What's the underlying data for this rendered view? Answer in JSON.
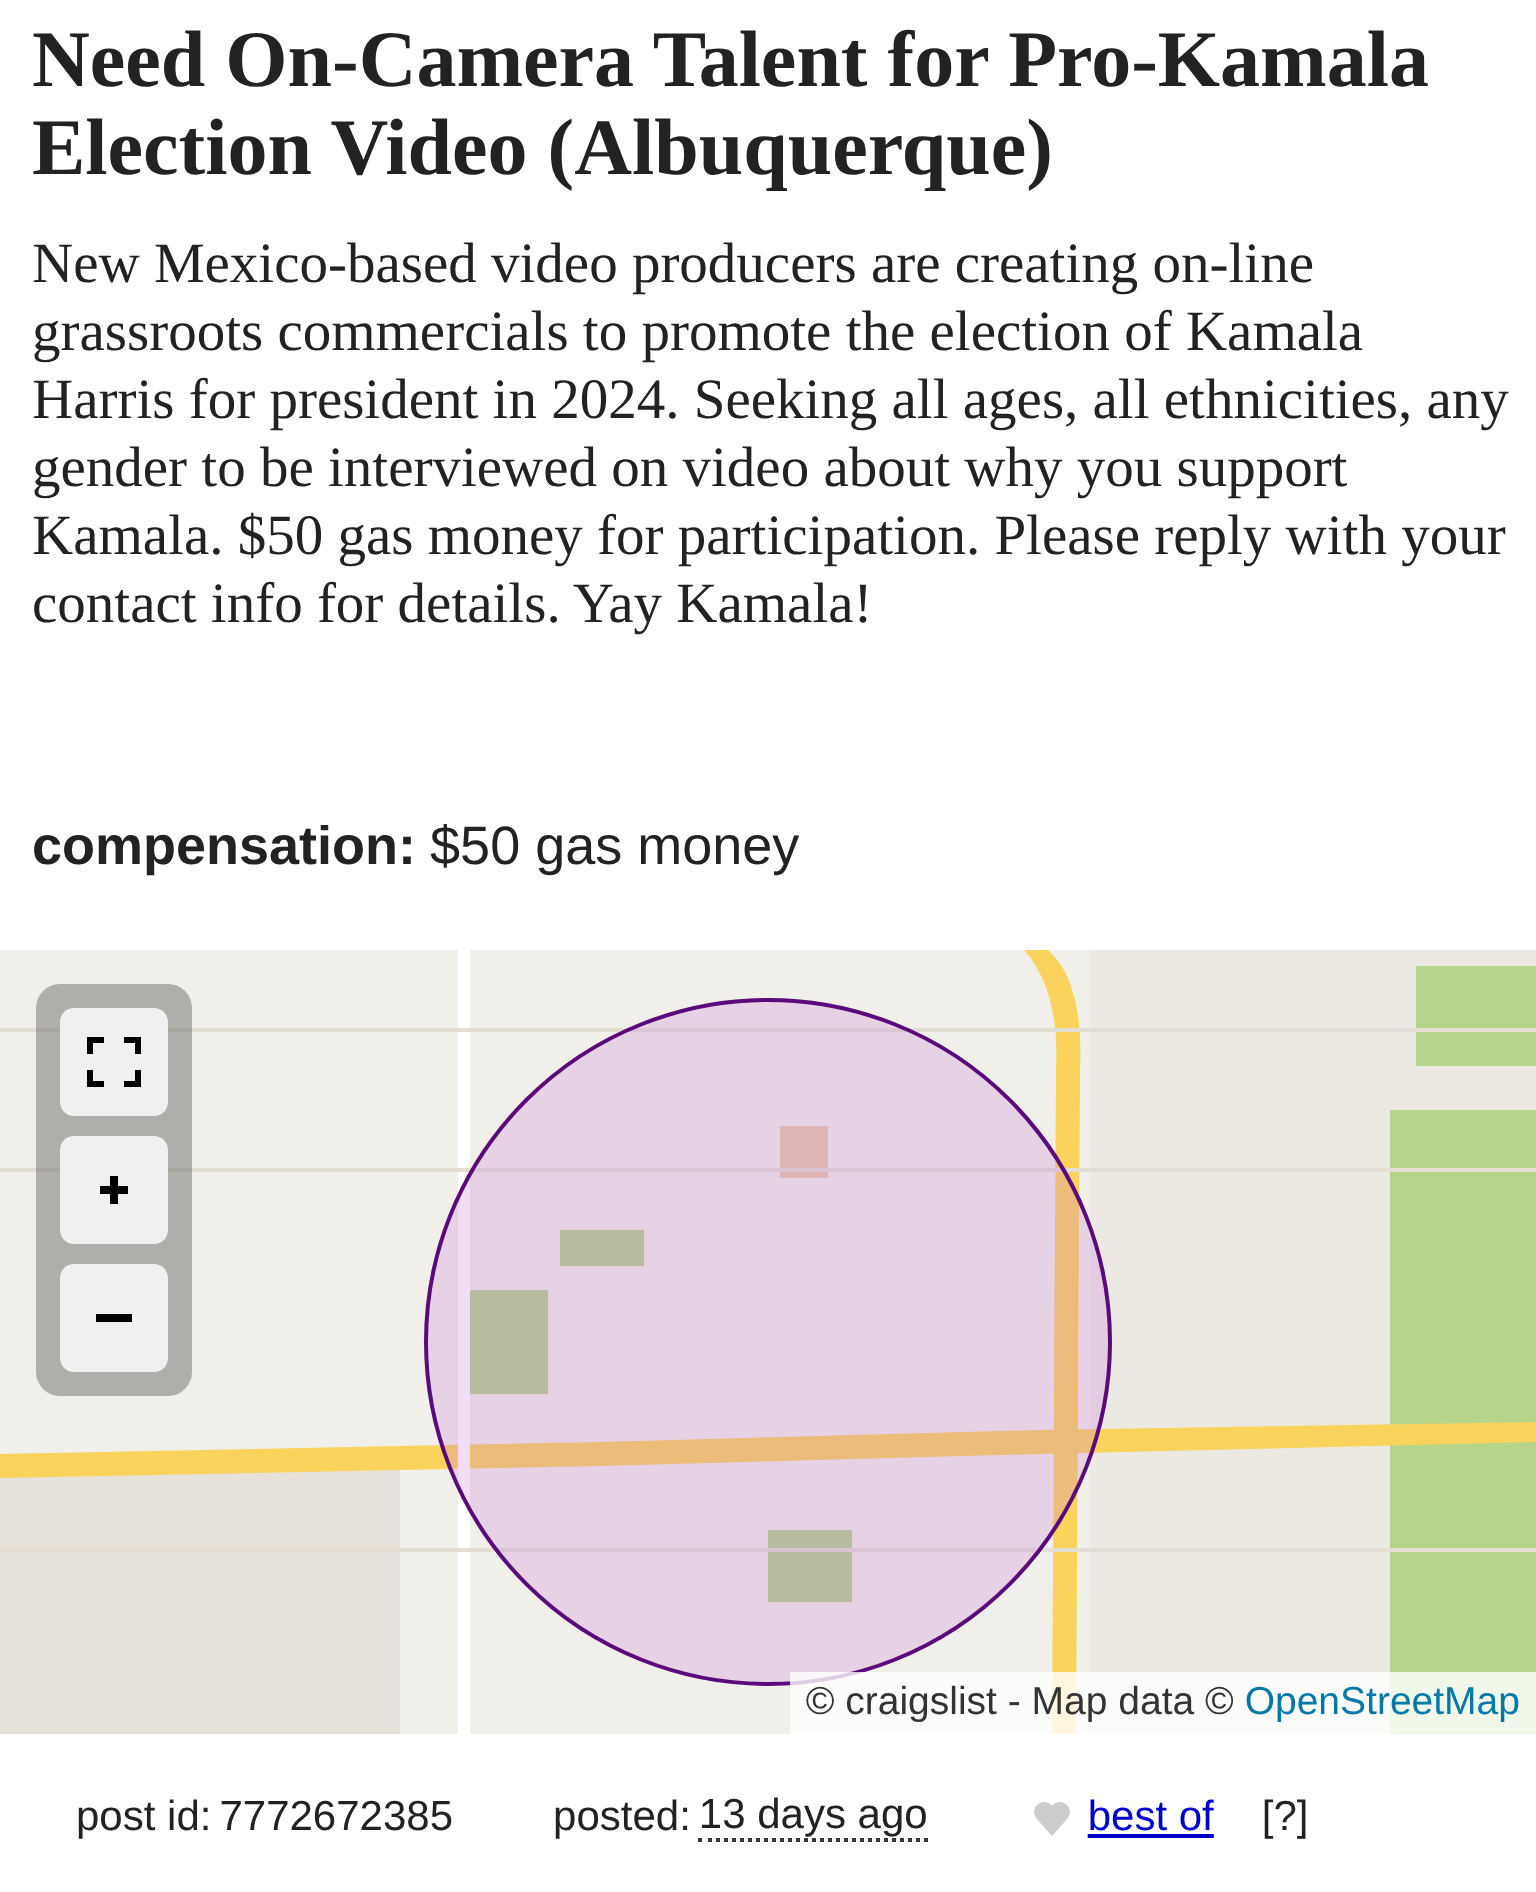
{
  "posting": {
    "title": "Need On-Camera Talent for Pro-Kamala Election Video (Albuquerque)",
    "body": "New Mexico-based video producers are creating on-line grassroots commercials to promote the election of Kamala Harris for president in 2024. Seeking all ages, all ethnicities, any gender to be interviewed on video about why you support Kamala. $50 gas money for participation. Please reply with your contact info for details. Yay Kamala!"
  },
  "attributes": [
    {
      "label": "compensation:",
      "value": "$50 gas money"
    }
  ],
  "map": {
    "attribution": "© craigslist - Map data ©",
    "attribution_link": "OpenStreetMap"
  },
  "footer": {
    "post_id_label": "post id:",
    "post_id": "7772672385",
    "posted_label": "posted:",
    "posted": "13 days ago",
    "best_of": "best of",
    "help": "[?]"
  }
}
